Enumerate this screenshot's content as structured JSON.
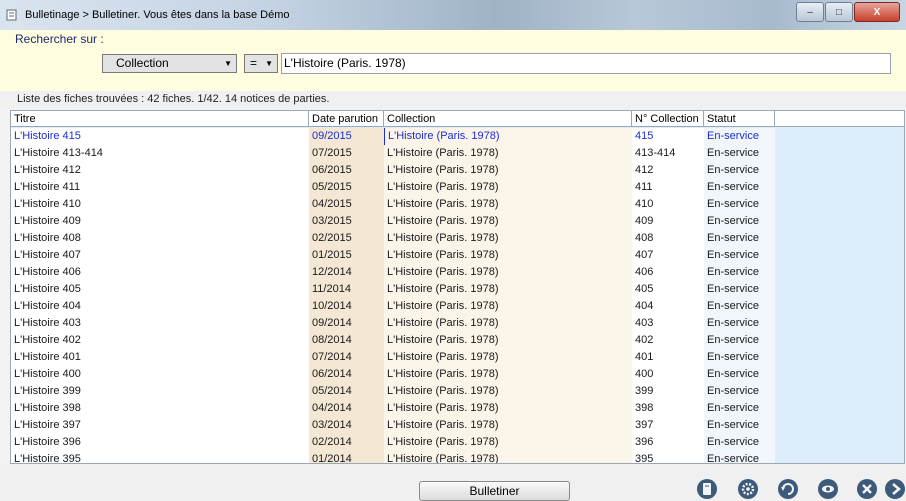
{
  "window": {
    "title": "Bulletinage > Bulletiner.  Vous êtes dans la base Démo",
    "buttons": {
      "minimize": "–",
      "maximize": "□",
      "close": "X"
    }
  },
  "search": {
    "label": "Rechercher sur :",
    "field": "Collection",
    "operator": "=",
    "value": "L'Histoire (Paris. 1978)"
  },
  "results": {
    "summary": "Liste des fiches trouvées : 42 fiches.  1/42. 14 notices de parties."
  },
  "table": {
    "columns": [
      "Titre",
      "Date parution",
      "Collection",
      "N° Collection",
      "Statut"
    ],
    "rows": [
      [
        "L'Histoire 415",
        "09/2015",
        "L'Histoire (Paris. 1978)",
        "415",
        "En-service"
      ],
      [
        "L'Histoire 413-414",
        "07/2015",
        "L'Histoire (Paris. 1978)",
        "413-414",
        "En-service"
      ],
      [
        "L'Histoire 412",
        "06/2015",
        "L'Histoire (Paris. 1978)",
        "412",
        "En-service"
      ],
      [
        "L'Histoire 411",
        "05/2015",
        "L'Histoire (Paris. 1978)",
        "411",
        "En-service"
      ],
      [
        "L'Histoire 410",
        "04/2015",
        "L'Histoire (Paris. 1978)",
        "410",
        "En-service"
      ],
      [
        "L'Histoire 409",
        "03/2015",
        "L'Histoire (Paris. 1978)",
        "409",
        "En-service"
      ],
      [
        "L'Histoire 408",
        "02/2015",
        "L'Histoire (Paris. 1978)",
        "408",
        "En-service"
      ],
      [
        "L'Histoire 407",
        "01/2015",
        "L'Histoire (Paris. 1978)",
        "407",
        "En-service"
      ],
      [
        "L'Histoire 406",
        "12/2014",
        "L'Histoire (Paris. 1978)",
        "406",
        "En-service"
      ],
      [
        "L'Histoire 405",
        "11/2014",
        "L'Histoire (Paris. 1978)",
        "405",
        "En-service"
      ],
      [
        "L'Histoire 404",
        "10/2014",
        "L'Histoire (Paris. 1978)",
        "404",
        "En-service"
      ],
      [
        "L'Histoire 403",
        "09/2014",
        "L'Histoire (Paris. 1978)",
        "403",
        "En-service"
      ],
      [
        "L'Histoire 402",
        "08/2014",
        "L'Histoire (Paris. 1978)",
        "402",
        "En-service"
      ],
      [
        "L'Histoire 401",
        "07/2014",
        "L'Histoire (Paris. 1978)",
        "401",
        "En-service"
      ],
      [
        "L'Histoire 400",
        "06/2014",
        "L'Histoire (Paris. 1978)",
        "400",
        "En-service"
      ],
      [
        "L'Histoire 399",
        "05/2014",
        "L'Histoire (Paris. 1978)",
        "399",
        "En-service"
      ],
      [
        "L'Histoire 398",
        "04/2014",
        "L'Histoire (Paris. 1978)",
        "398",
        "En-service"
      ],
      [
        "L'Histoire 397",
        "03/2014",
        "L'Histoire (Paris. 1978)",
        "397",
        "En-service"
      ],
      [
        "L'Histoire 396",
        "02/2014",
        "L'Histoire (Paris. 1978)",
        "396",
        "En-service"
      ],
      [
        "L'Histoire 395",
        "01/2014",
        "L'Histoire (Paris. 1978)",
        "395",
        "En-service"
      ]
    ]
  },
  "footer": {
    "bulletiner_label": "Bulletiner",
    "tools": [
      "book-icon",
      "settings-icon",
      "refresh-icon",
      "view-icon",
      "delete-icon",
      "next-icon"
    ]
  },
  "colors": {
    "selected_text": "#1c2fcf",
    "search_bg": "#fffde0",
    "table_bg": "#ddeefa"
  }
}
